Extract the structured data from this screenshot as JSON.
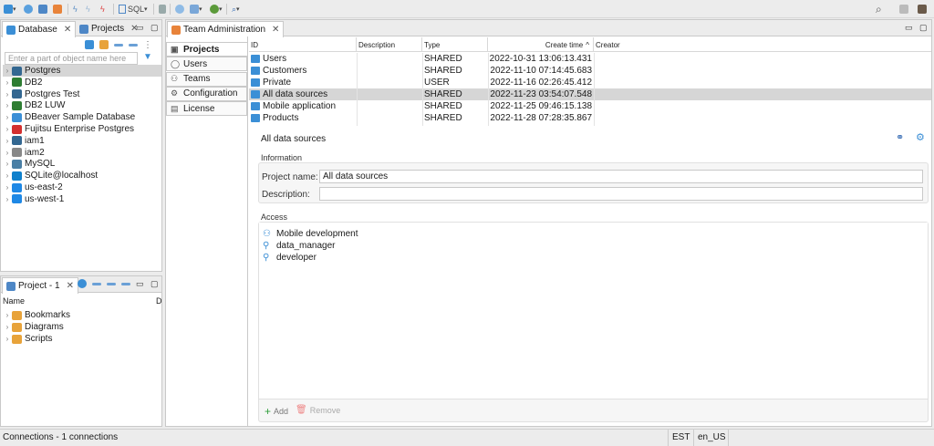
{
  "toolbar": {
    "sql_label": "SQL",
    "icons": [
      "new-connection-icon",
      "connect-icon",
      "open-folder-icon",
      "db-folder-icon",
      "flash-icon",
      "flash-off-icon",
      "tx-icon",
      "sql-editor-icon",
      "lock-icon",
      "cloud-icon",
      "compare-icon",
      "debug-icon",
      "search-toolbar-icon",
      "global-search-icon",
      "prefs-icon",
      "avatar"
    ]
  },
  "db_panel": {
    "tabs": [
      {
        "label": "Database"
      },
      {
        "label": "Projects"
      }
    ],
    "filter_placeholder": "Enter a part of object name here",
    "items": [
      {
        "label": "Postgres",
        "icon": "postgres-icon",
        "color": "#336791",
        "selected": true
      },
      {
        "label": "DB2",
        "icon": "db2-icon",
        "color": "#2e7d32"
      },
      {
        "label": "Postgres Test",
        "icon": "postgres-icon",
        "color": "#336791"
      },
      {
        "label": "DB2 LUW",
        "icon": "db2-icon",
        "color": "#2e7d32"
      },
      {
        "label": "DBeaver Sample Database",
        "icon": "dbeaver-icon",
        "color": "#3b8fd6"
      },
      {
        "label": "Fujitsu Enterprise Postgres",
        "icon": "fujitsu-icon",
        "color": "#d32f2f"
      },
      {
        "label": "iam1",
        "icon": "postgres-icon",
        "color": "#336791"
      },
      {
        "label": "iam2",
        "icon": "plain-icon",
        "color": "#888888"
      },
      {
        "label": "MySQL",
        "icon": "mysql-icon",
        "color": "#4a7fa5"
      },
      {
        "label": "SQLite@localhost",
        "icon": "sqlite-icon",
        "color": "#0f80cc"
      },
      {
        "label": "us-east-2",
        "icon": "aws-icon",
        "color": "#1e88e5"
      },
      {
        "label": "us-west-1",
        "icon": "aws-icon",
        "color": "#1e88e5"
      }
    ]
  },
  "project_panel": {
    "title": "Project - 1",
    "col_name": "Name",
    "col_d": "D",
    "items": [
      {
        "label": "Bookmarks"
      },
      {
        "label": "Diagrams"
      },
      {
        "label": "Scripts"
      }
    ]
  },
  "admin": {
    "tab_label": "Team Administration",
    "side_tabs": [
      {
        "label": "Projects",
        "icon": "projects-icon",
        "active": true
      },
      {
        "label": "Users",
        "icon": "user-icon"
      },
      {
        "label": "Teams",
        "icon": "team-icon"
      },
      {
        "label": "Configuration",
        "icon": "gear-icon"
      },
      {
        "label": "License",
        "icon": "license-icon"
      }
    ],
    "columns": {
      "id": "ID",
      "description": "Description",
      "type": "Type",
      "create_time": "Create time",
      "sort_indicator": "^",
      "creator": "Creator"
    },
    "rows": [
      {
        "id": "Users",
        "description": "",
        "type": "SHARED",
        "create_time": "2022-10-31 13:06:13.431",
        "creator": ""
      },
      {
        "id": "Customers",
        "description": "",
        "type": "SHARED",
        "create_time": "2022-11-10 07:14:45.683",
        "creator": ""
      },
      {
        "id": "Private",
        "description": "",
        "type": "USER",
        "create_time": "2022-11-16 02:26:45.412",
        "creator": ""
      },
      {
        "id": "All data sources",
        "description": "",
        "type": "SHARED",
        "create_time": "2022-11-23 03:54:07.548",
        "creator": "",
        "selected": true
      },
      {
        "id": "Mobile application",
        "description": "",
        "type": "SHARED",
        "create_time": "2022-11-25 09:46:15.138",
        "creator": ""
      },
      {
        "id": "Products",
        "description": "",
        "type": "SHARED",
        "create_time": "2022-11-28 07:28:35.867",
        "creator": ""
      }
    ],
    "detail": {
      "title": "All data sources",
      "info_label": "Information",
      "project_name_label": "Project name:",
      "project_name_value": "All data sources",
      "description_label": "Description:",
      "description_value": "",
      "access_label": "Access",
      "access_items": [
        {
          "label": "Mobile development",
          "icon": "team-icon"
        },
        {
          "label": "data_manager",
          "icon": "user-icon"
        },
        {
          "label": "developer",
          "icon": "user-icon"
        }
      ],
      "add_label": "Add",
      "remove_label": "Remove"
    }
  },
  "status": {
    "connections": "Connections - 1 connections",
    "timezone": "EST",
    "locale": "en_US"
  }
}
